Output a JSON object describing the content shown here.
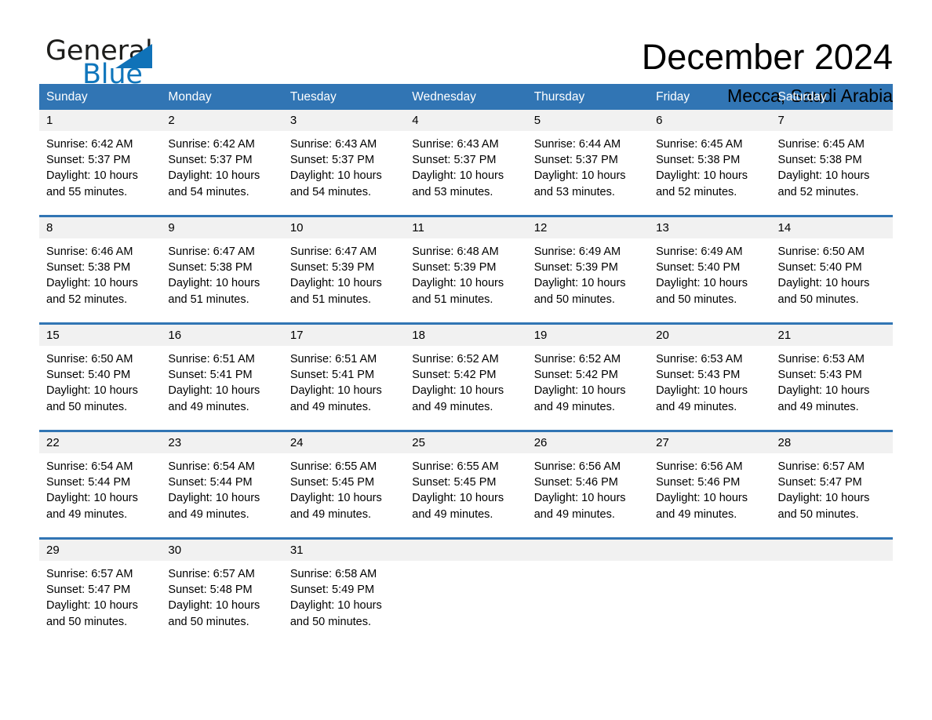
{
  "brand": {
    "name_part1": "General",
    "name_part2": "Blue",
    "triangle_icon": "triangle-icon",
    "accent_color": "#1072b8"
  },
  "header": {
    "month_title": "December 2024",
    "location": "Mecca, Saudi Arabia"
  },
  "theme": {
    "header_blue": "#3175b4",
    "daynum_gray": "#f1f1f1",
    "text_black": "#000000",
    "brand_blue": "#1076bc"
  },
  "calendar": {
    "weekdays": [
      "Sunday",
      "Monday",
      "Tuesday",
      "Wednesday",
      "Thursday",
      "Friday",
      "Saturday"
    ],
    "weeks": [
      [
        {
          "day": "1",
          "lines": [
            "Sunrise: 6:42 AM",
            "Sunset: 5:37 PM",
            "Daylight: 10 hours",
            "and 55 minutes."
          ]
        },
        {
          "day": "2",
          "lines": [
            "Sunrise: 6:42 AM",
            "Sunset: 5:37 PM",
            "Daylight: 10 hours",
            "and 54 minutes."
          ]
        },
        {
          "day": "3",
          "lines": [
            "Sunrise: 6:43 AM",
            "Sunset: 5:37 PM",
            "Daylight: 10 hours",
            "and 54 minutes."
          ]
        },
        {
          "day": "4",
          "lines": [
            "Sunrise: 6:43 AM",
            "Sunset: 5:37 PM",
            "Daylight: 10 hours",
            "and 53 minutes."
          ]
        },
        {
          "day": "5",
          "lines": [
            "Sunrise: 6:44 AM",
            "Sunset: 5:37 PM",
            "Daylight: 10 hours",
            "and 53 minutes."
          ]
        },
        {
          "day": "6",
          "lines": [
            "Sunrise: 6:45 AM",
            "Sunset: 5:38 PM",
            "Daylight: 10 hours",
            "and 52 minutes."
          ]
        },
        {
          "day": "7",
          "lines": [
            "Sunrise: 6:45 AM",
            "Sunset: 5:38 PM",
            "Daylight: 10 hours",
            "and 52 minutes."
          ]
        }
      ],
      [
        {
          "day": "8",
          "lines": [
            "Sunrise: 6:46 AM",
            "Sunset: 5:38 PM",
            "Daylight: 10 hours",
            "and 52 minutes."
          ]
        },
        {
          "day": "9",
          "lines": [
            "Sunrise: 6:47 AM",
            "Sunset: 5:38 PM",
            "Daylight: 10 hours",
            "and 51 minutes."
          ]
        },
        {
          "day": "10",
          "lines": [
            "Sunrise: 6:47 AM",
            "Sunset: 5:39 PM",
            "Daylight: 10 hours",
            "and 51 minutes."
          ]
        },
        {
          "day": "11",
          "lines": [
            "Sunrise: 6:48 AM",
            "Sunset: 5:39 PM",
            "Daylight: 10 hours",
            "and 51 minutes."
          ]
        },
        {
          "day": "12",
          "lines": [
            "Sunrise: 6:49 AM",
            "Sunset: 5:39 PM",
            "Daylight: 10 hours",
            "and 50 minutes."
          ]
        },
        {
          "day": "13",
          "lines": [
            "Sunrise: 6:49 AM",
            "Sunset: 5:40 PM",
            "Daylight: 10 hours",
            "and 50 minutes."
          ]
        },
        {
          "day": "14",
          "lines": [
            "Sunrise: 6:50 AM",
            "Sunset: 5:40 PM",
            "Daylight: 10 hours",
            "and 50 minutes."
          ]
        }
      ],
      [
        {
          "day": "15",
          "lines": [
            "Sunrise: 6:50 AM",
            "Sunset: 5:40 PM",
            "Daylight: 10 hours",
            "and 50 minutes."
          ]
        },
        {
          "day": "16",
          "lines": [
            "Sunrise: 6:51 AM",
            "Sunset: 5:41 PM",
            "Daylight: 10 hours",
            "and 49 minutes."
          ]
        },
        {
          "day": "17",
          "lines": [
            "Sunrise: 6:51 AM",
            "Sunset: 5:41 PM",
            "Daylight: 10 hours",
            "and 49 minutes."
          ]
        },
        {
          "day": "18",
          "lines": [
            "Sunrise: 6:52 AM",
            "Sunset: 5:42 PM",
            "Daylight: 10 hours",
            "and 49 minutes."
          ]
        },
        {
          "day": "19",
          "lines": [
            "Sunrise: 6:52 AM",
            "Sunset: 5:42 PM",
            "Daylight: 10 hours",
            "and 49 minutes."
          ]
        },
        {
          "day": "20",
          "lines": [
            "Sunrise: 6:53 AM",
            "Sunset: 5:43 PM",
            "Daylight: 10 hours",
            "and 49 minutes."
          ]
        },
        {
          "day": "21",
          "lines": [
            "Sunrise: 6:53 AM",
            "Sunset: 5:43 PM",
            "Daylight: 10 hours",
            "and 49 minutes."
          ]
        }
      ],
      [
        {
          "day": "22",
          "lines": [
            "Sunrise: 6:54 AM",
            "Sunset: 5:44 PM",
            "Daylight: 10 hours",
            "and 49 minutes."
          ]
        },
        {
          "day": "23",
          "lines": [
            "Sunrise: 6:54 AM",
            "Sunset: 5:44 PM",
            "Daylight: 10 hours",
            "and 49 minutes."
          ]
        },
        {
          "day": "24",
          "lines": [
            "Sunrise: 6:55 AM",
            "Sunset: 5:45 PM",
            "Daylight: 10 hours",
            "and 49 minutes."
          ]
        },
        {
          "day": "25",
          "lines": [
            "Sunrise: 6:55 AM",
            "Sunset: 5:45 PM",
            "Daylight: 10 hours",
            "and 49 minutes."
          ]
        },
        {
          "day": "26",
          "lines": [
            "Sunrise: 6:56 AM",
            "Sunset: 5:46 PM",
            "Daylight: 10 hours",
            "and 49 minutes."
          ]
        },
        {
          "day": "27",
          "lines": [
            "Sunrise: 6:56 AM",
            "Sunset: 5:46 PM",
            "Daylight: 10 hours",
            "and 49 minutes."
          ]
        },
        {
          "day": "28",
          "lines": [
            "Sunrise: 6:57 AM",
            "Sunset: 5:47 PM",
            "Daylight: 10 hours",
            "and 50 minutes."
          ]
        }
      ],
      [
        {
          "day": "29",
          "lines": [
            "Sunrise: 6:57 AM",
            "Sunset: 5:47 PM",
            "Daylight: 10 hours",
            "and 50 minutes."
          ]
        },
        {
          "day": "30",
          "lines": [
            "Sunrise: 6:57 AM",
            "Sunset: 5:48 PM",
            "Daylight: 10 hours",
            "and 50 minutes."
          ]
        },
        {
          "day": "31",
          "lines": [
            "Sunrise: 6:58 AM",
            "Sunset: 5:49 PM",
            "Daylight: 10 hours",
            "and 50 minutes."
          ]
        },
        {
          "day": "",
          "lines": []
        },
        {
          "day": "",
          "lines": []
        },
        {
          "day": "",
          "lines": []
        },
        {
          "day": "",
          "lines": []
        }
      ]
    ]
  }
}
